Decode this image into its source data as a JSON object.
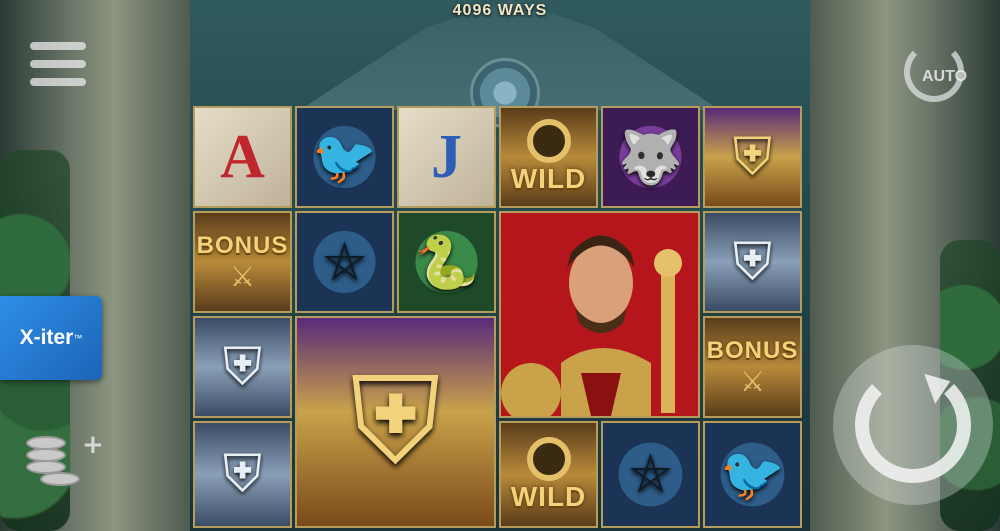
{
  "header": {
    "ways_label": "4096 WAYS"
  },
  "hud": {
    "menu_icon": "hamburger-menu-icon",
    "feature_badge": {
      "text": "X-iter",
      "trademark": "™"
    },
    "bet_icon": "coin-stack-plus-icon",
    "autoplay": {
      "label": "AUTO",
      "icon": "autoplay-icon"
    },
    "spin_icon": "spin-arrow-icon"
  },
  "reels": {
    "col1": [
      {
        "symbol": "A",
        "kind": "letter",
        "color": "#c0262d"
      },
      {
        "symbol": "BONUS",
        "kind": "bonus"
      },
      {
        "symbol": "helmet",
        "kind": "helmet"
      },
      {
        "symbol": "helmet",
        "kind": "helmet"
      }
    ],
    "col2": [
      {
        "symbol": "raven",
        "kind": "emblem"
      },
      {
        "symbol": "pentagram",
        "kind": "emblem"
      },
      {
        "symbol": "golden-helmet",
        "kind": "giant-2x2"
      }
    ],
    "col3": [
      {
        "symbol": "J",
        "kind": "letter",
        "color": "#2e5db8"
      },
      {
        "symbol": "serpent",
        "kind": "emblem"
      }
    ],
    "col4": [
      {
        "symbol": "WILD",
        "kind": "wild"
      },
      {
        "symbol": "WILD",
        "kind": "wild"
      }
    ],
    "col5": [
      {
        "symbol": "wolf",
        "kind": "emblem"
      },
      {
        "symbol": "pentagram",
        "kind": "emblem"
      }
    ],
    "col6": [
      {
        "symbol": "golden-helmet",
        "kind": "helmet"
      },
      {
        "symbol": "helmet",
        "kind": "helmet"
      },
      {
        "symbol": "BONUS",
        "kind": "bonus"
      },
      {
        "symbol": "raven",
        "kind": "emblem"
      }
    ],
    "knight_giant": {
      "symbol": "knight",
      "kind": "giant-2x2"
    }
  }
}
